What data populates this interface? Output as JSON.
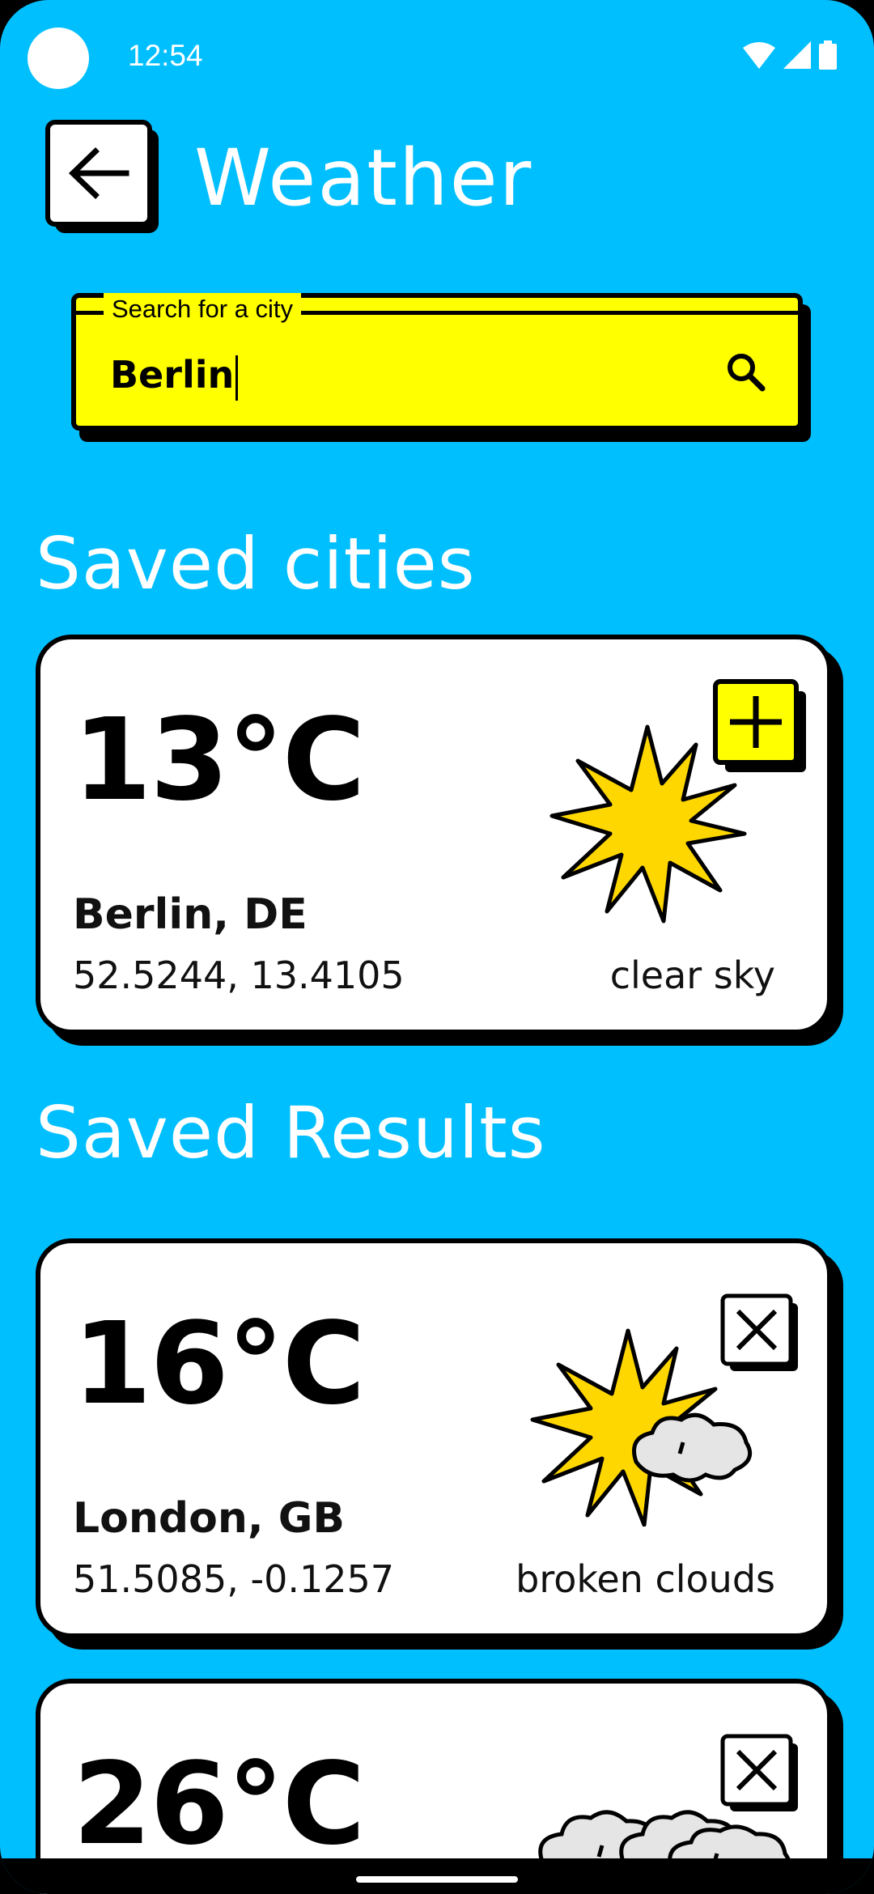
{
  "status_bar": {
    "time": "12:54"
  },
  "app_bar": {
    "title": "Weather",
    "back_icon": "arrow-left-icon"
  },
  "search": {
    "label": "Search for a city",
    "value": "Berlin",
    "icon": "search-icon"
  },
  "sections": {
    "saved_cities": "Saved cities",
    "saved_results": "Saved Results"
  },
  "saved_cities": [
    {
      "temp": "13°C",
      "city": "Berlin, DE",
      "coords": "52.5244, 13.4105",
      "description": "clear sky",
      "icon": "sun-icon",
      "action_icon": "plus-icon"
    }
  ],
  "saved_results": [
    {
      "temp": "16°C",
      "city": "London, GB",
      "coords": "51.5085, -0.1257",
      "description": "broken clouds",
      "icon": "sun-cloud-icon",
      "action_icon": "close-icon"
    },
    {
      "temp": "26°C",
      "city": "",
      "coords": "",
      "description": "",
      "icon": "clouds-icon",
      "action_icon": "close-icon"
    }
  ],
  "colors": {
    "background": "#00BFFF",
    "search_fill": "#FFFF00",
    "sun_fill": "#FFD700",
    "add_button_fill": "#FFFF00",
    "card": "#FFFFFF",
    "outline": "#000000",
    "cloud_fill": "#E5E5E5"
  }
}
